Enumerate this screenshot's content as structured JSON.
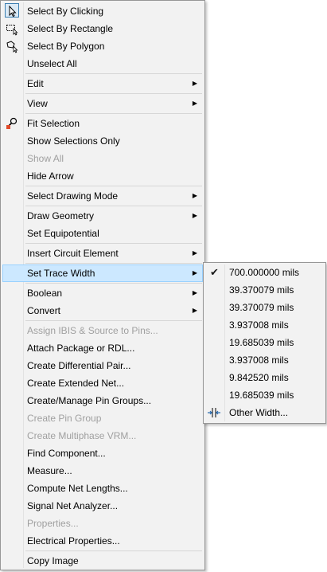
{
  "main_menu": {
    "items": [
      {
        "label": "Select By Clicking",
        "icon": "pointer-select-icon"
      },
      {
        "label": "Select By Rectangle",
        "icon": "rectangle-select-icon"
      },
      {
        "label": "Select By Polygon",
        "icon": "polygon-select-icon"
      },
      {
        "label": "Unselect All"
      },
      {
        "label": "Edit",
        "submenu": true
      },
      {
        "label": "View",
        "submenu": true
      },
      {
        "label": "Fit Selection",
        "icon": "magnifier-icon"
      },
      {
        "label": "Show Selections Only"
      },
      {
        "label": "Show All",
        "disabled": true
      },
      {
        "label": "Hide Arrow"
      },
      {
        "label": "Select Drawing Mode",
        "submenu": true
      },
      {
        "label": "Draw Geometry",
        "submenu": true
      },
      {
        "label": "Set Equipotential"
      },
      {
        "label": "Insert Circuit Element",
        "submenu": true
      },
      {
        "label": "Set Trace Width",
        "submenu": true,
        "highlighted": true
      },
      {
        "label": "Boolean",
        "submenu": true
      },
      {
        "label": "Convert",
        "submenu": true
      },
      {
        "label": "Assign IBIS & Source to Pins...",
        "disabled": true
      },
      {
        "label": "Attach Package or RDL..."
      },
      {
        "label": "Create Differential Pair..."
      },
      {
        "label": "Create Extended Net..."
      },
      {
        "label": "Create/Manage Pin Groups..."
      },
      {
        "label": "Create Pin Group",
        "disabled": true
      },
      {
        "label": "Create Multiphase VRM...",
        "disabled": true
      },
      {
        "label": "Find Component..."
      },
      {
        "label": "Measure..."
      },
      {
        "label": "Compute Net Lengths..."
      },
      {
        "label": "Signal Net Analyzer..."
      },
      {
        "label": "Properties...",
        "disabled": true
      },
      {
        "label": "Electrical Properties..."
      },
      {
        "label": "Copy Image"
      }
    ]
  },
  "trace_width_submenu": {
    "items": [
      {
        "label": "700.000000 mils",
        "checked": true
      },
      {
        "label": "39.370079 mils"
      },
      {
        "label": "39.370079 mils"
      },
      {
        "label": "3.937008 mils"
      },
      {
        "label": "19.685039 mils"
      },
      {
        "label": "3.937008 mils"
      },
      {
        "label": "9.842520 mils"
      },
      {
        "label": "19.685039 mils"
      },
      {
        "label": "Other Width...",
        "icon": "width-adjust-icon"
      }
    ],
    "check_glyph": "✔"
  },
  "submenu_arrow_glyph": "▶",
  "colors": {
    "highlight_bg": "#cce8ff",
    "highlight_border": "#99d1ff",
    "disabled_text": "#a0a0a0"
  }
}
